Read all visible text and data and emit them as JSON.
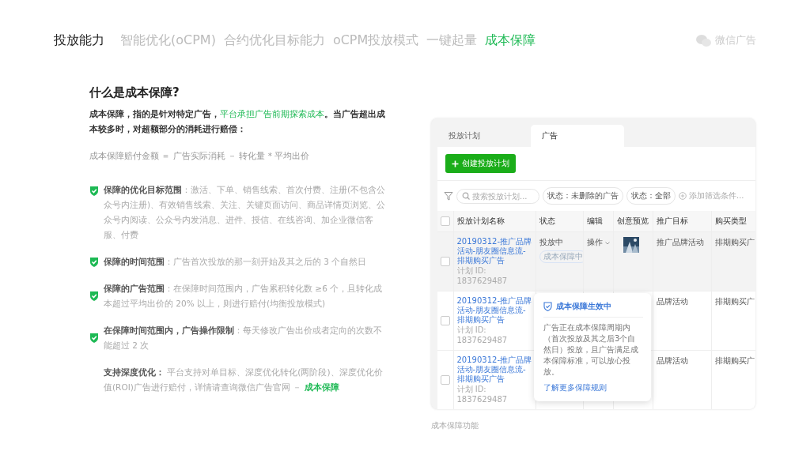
{
  "nav": {
    "items": [
      {
        "label": "投放能力",
        "kind": "heading"
      },
      {
        "label": "智能优化(oCPM)",
        "kind": "tab",
        "selected": false
      },
      {
        "label": "合约优化目标能力",
        "kind": "tab",
        "selected": false
      },
      {
        "label": "oCPM投放模式",
        "kind": "tab",
        "selected": false
      },
      {
        "label": "一键起量",
        "kind": "tab",
        "selected": false
      },
      {
        "label": "成本保障",
        "kind": "tab",
        "selected": true
      }
    ],
    "logo": "微信广告"
  },
  "article": {
    "title": "什么是成本保障?",
    "intro": [
      {
        "text": "成本保障，指的是针对特定广告，",
        "kind": "plain"
      },
      {
        "text": "平台承担广告前期探索成本",
        "kind": "highlight"
      },
      {
        "text": "。当广告超出成本较多时，对超额部分的消耗进行赔偿：",
        "kind": "plain"
      }
    ],
    "formula": "成本保障赔付金额 ＝ 广告实际消耗 － 转化量 * 平均出价",
    "bullets": [
      {
        "kind": "guarantee",
        "label": "保障的优化目标范围",
        "text": "：激活、下单、销售线索、首次付费、注册(不包含公众号内注册)、有效销售线索、关注、关键页面访问、商品详情页浏览、公众号内阅读、公众号内发消息、进件、授信、在线咨询、加企业微信客服、付费"
      },
      {
        "kind": "guarantee",
        "label": "保障的时间范围",
        "text": "：广告首次投放的那一刻开始及其之后的 3 个自然日"
      },
      {
        "kind": "guarantee",
        "label": "保障的广告范围",
        "text": "：在保障时间范围内，广告累积转化数 ≥6 个，且转化成本超过平均出价的 20% 以上，则进行赔付(均衡投放模式)"
      },
      {
        "kind": "guarantee",
        "label": "在保障时间范围内，广告操作限制",
        "text": "：每天修改广告出价或者定向的次数不能超过 2 次"
      },
      {
        "kind": "note",
        "label": "支持深度优化：",
        "text": "   平台支持对单目标、深度优化转化(两阶段)、深度优化价值(ROI)广告进行赔付，详情请查询微信广告官网 － ",
        "link": "成本保障"
      }
    ]
  },
  "mock": {
    "tabs": [
      {
        "label": "投放计划",
        "selected": false
      },
      {
        "label": "广告",
        "selected": true
      }
    ],
    "create_button": "创建投放计划",
    "search": {
      "placeholder": "搜索投放计划..."
    },
    "chips": [
      "状态：未删除的广告",
      "状态：全部"
    ],
    "add_filter": "添加筛选条件...",
    "header_checked": false,
    "columns": [
      "投放计划名称",
      "状态",
      "编辑",
      "创意预览",
      "推广目标",
      "购买类型"
    ],
    "rows": [
      {
        "hovered": true,
        "checked": false,
        "name": "20190312-推广品牌活动-朋友圈信息流-排期购买广告",
        "plan_id": "计划 ID: 1837629487",
        "status": "投放中",
        "badge": "成本保障中",
        "edit": "操作",
        "target": "推广品牌活动",
        "buy": "排期购买广"
      },
      {
        "hovered": false,
        "checked": false,
        "name": "20190312-推广品牌活动-朋友圈信息流-排期购买广告",
        "plan_id": "计划 ID: 1837629487",
        "target": "品牌活动",
        "buy": "排期购买广"
      },
      {
        "hovered": false,
        "checked": false,
        "name": "20190312-推广品牌活动-朋友圈信息流-排期购买广告",
        "plan_id": "计划 ID: 1837629487",
        "target": "品牌活动",
        "buy": "排期购买广"
      }
    ],
    "popover": {
      "title": "成本保障生效中",
      "body": "广告正在成本保障周期内（首次投放及其之后3个自然日）投放，且广告满足成本保障标准，可以放心投放。",
      "link": "了解更多保障规则"
    },
    "caption": "成本保障功能"
  }
}
